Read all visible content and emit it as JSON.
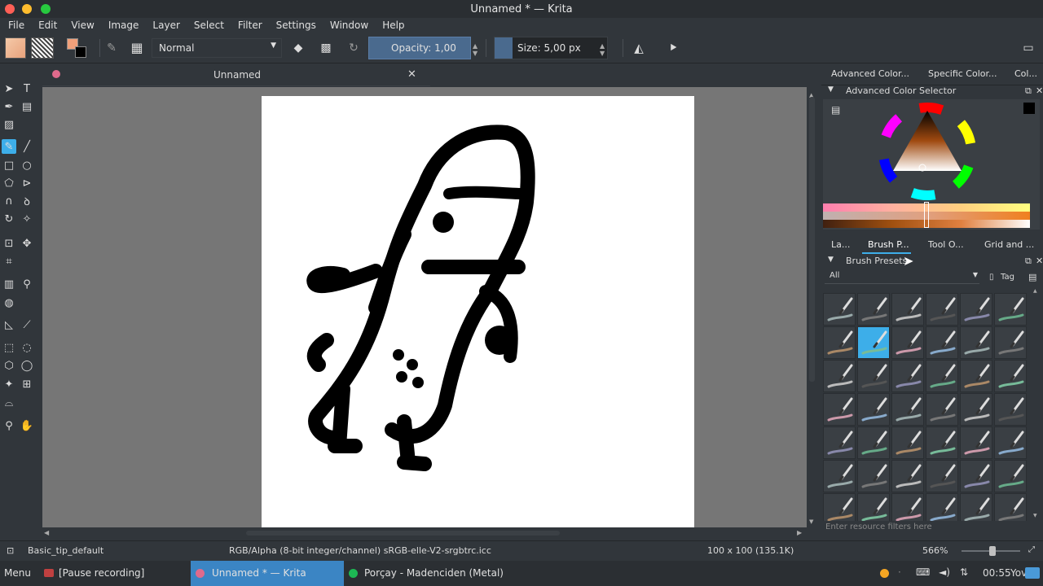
{
  "window": {
    "title": "Unnamed * — Krita"
  },
  "menu": [
    "File",
    "Edit",
    "View",
    "Image",
    "Layer",
    "Select",
    "Filter",
    "Settings",
    "Window",
    "Help"
  ],
  "toolbar": {
    "blend_mode": "Normal",
    "opacity_label": "Opacity:  1,00",
    "size_label": "Size:  5,00 px"
  },
  "document": {
    "tab_title": "Unnamed"
  },
  "dock": {
    "top_tabs": [
      "Advanced Color...",
      "Specific Color...",
      "Col..."
    ],
    "color_panel_title": "Advanced Color Selector",
    "mid_tabs": [
      "La...",
      "Brush P...",
      "Tool O...",
      "Grid and ..."
    ],
    "brush_panel_title": "Brush Presets",
    "filter_value": "All",
    "tag_label": "Tag",
    "resource_filter_placeholder": "Enter resource filters here"
  },
  "status": {
    "brush_name": "Basic_tip_default",
    "color_info": "RGB/Alpha (8-bit integer/channel)  sRGB-elle-V2-srgbtrc.icc",
    "image_size": "100 x 100 (135.1K)",
    "zoom": "566%"
  },
  "taskbar": {
    "menu_label": "Menu",
    "items": [
      "[Pause recording]",
      "Unnamed * — Krita",
      "Porçay - Madenciden (Metal)"
    ],
    "clock": "00:55",
    "user": "Yovz"
  },
  "colors": {
    "accent": "#3daee9",
    "foreground_color": "#f0a07a",
    "active_task": "#3b85c4"
  }
}
